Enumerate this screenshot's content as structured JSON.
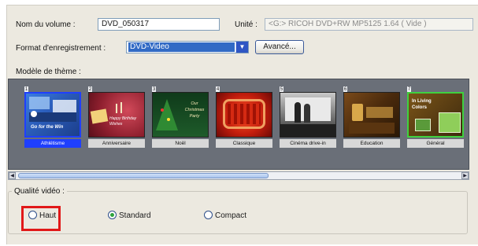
{
  "volume": {
    "name_label": "Nom du volume :",
    "name_value": "DVD_050317",
    "unit_label": "Unité :",
    "unit_value": "<G:> RICOH DVD+RW MP5125 1.64 ( Vide )"
  },
  "format": {
    "label": "Format d'enregistrement :",
    "selected": "DVD-Video",
    "advanced_button": "Avancé..."
  },
  "themes": {
    "label": "Modèle de thème :",
    "items": [
      {
        "num": "1",
        "caption": "Athlétisme",
        "thumb_text": "Go for the Win",
        "selected": true
      },
      {
        "num": "2",
        "caption": "Anniversaire",
        "thumb_text": "Happy Birthday Wishes",
        "selected": false
      },
      {
        "num": "3",
        "caption": "Noël",
        "thumb_text": "Our Christmas Party",
        "selected": false
      },
      {
        "num": "4",
        "caption": "Classique",
        "thumb_text": "",
        "selected": false
      },
      {
        "num": "5",
        "caption": "Cinéma drive-in",
        "thumb_text": "",
        "selected": false
      },
      {
        "num": "6",
        "caption": "Education",
        "thumb_text": "",
        "selected": false
      },
      {
        "num": "7",
        "caption": "Général",
        "thumb_text": "In Living Colors",
        "selected": false
      }
    ]
  },
  "quality": {
    "legend": "Qualité vidéo :",
    "options": [
      {
        "label": "Haut",
        "checked": false
      },
      {
        "label": "Standard",
        "checked": true
      },
      {
        "label": "Compact",
        "checked": false
      }
    ]
  },
  "colors": {
    "panel": "#ece9e0",
    "selection_blue": "#1f3fff",
    "highlight_red": "#e11818"
  }
}
